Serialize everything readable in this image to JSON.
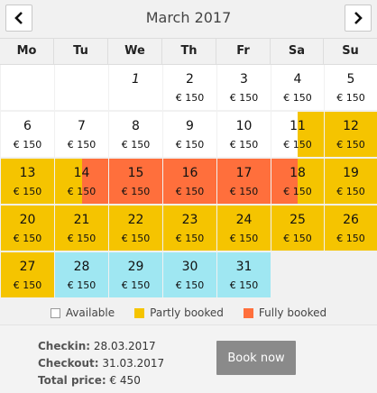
{
  "header": {
    "month": "March 2017"
  },
  "weekdays": [
    "Mo",
    "Tu",
    "We",
    "Th",
    "Fr",
    "Sa",
    "Su"
  ],
  "colors": {
    "available": "#ffffff",
    "partly": "#f5c400",
    "fully": "#ff6f3c",
    "selected": "#9fe7f2"
  },
  "calendar": {
    "days": [
      {
        "day": "1",
        "price": "",
        "status": "available",
        "italic": true
      },
      {
        "day": "2",
        "price": "€ 150",
        "status": "available"
      },
      {
        "day": "3",
        "price": "€ 150",
        "status": "available"
      },
      {
        "day": "4",
        "price": "€ 150",
        "status": "available"
      },
      {
        "day": "5",
        "price": "€ 150",
        "status": "available"
      },
      {
        "day": "6",
        "price": "€ 150",
        "status": "available"
      },
      {
        "day": "7",
        "price": "€ 150",
        "status": "available"
      },
      {
        "day": "8",
        "price": "€ 150",
        "status": "available"
      },
      {
        "day": "9",
        "price": "€ 150",
        "status": "available"
      },
      {
        "day": "10",
        "price": "€ 150",
        "status": "available"
      },
      {
        "day": "11",
        "price": "€ 150",
        "status": "partly-checkin"
      },
      {
        "day": "12",
        "price": "€ 150",
        "status": "partly"
      },
      {
        "day": "13",
        "price": "€ 150",
        "status": "partly"
      },
      {
        "day": "14",
        "price": "€ 150",
        "status": "fully-checkin"
      },
      {
        "day": "15",
        "price": "€ 150",
        "status": "fully"
      },
      {
        "day": "16",
        "price": "€ 150",
        "status": "fully"
      },
      {
        "day": "17",
        "price": "€ 150",
        "status": "fully"
      },
      {
        "day": "18",
        "price": "€ 150",
        "status": "fully-checkout"
      },
      {
        "day": "19",
        "price": "€ 150",
        "status": "partly"
      },
      {
        "day": "20",
        "price": "€ 150",
        "status": "partly"
      },
      {
        "day": "21",
        "price": "€ 150",
        "status": "partly"
      },
      {
        "day": "22",
        "price": "€ 150",
        "status": "partly"
      },
      {
        "day": "23",
        "price": "€ 150",
        "status": "partly"
      },
      {
        "day": "24",
        "price": "€ 150",
        "status": "partly"
      },
      {
        "day": "25",
        "price": "€ 150",
        "status": "partly"
      },
      {
        "day": "26",
        "price": "€ 150",
        "status": "partly"
      },
      {
        "day": "27",
        "price": "€ 150",
        "status": "partly"
      },
      {
        "day": "28",
        "price": "€ 150",
        "status": "selected"
      },
      {
        "day": "29",
        "price": "€ 150",
        "status": "selected"
      },
      {
        "day": "30",
        "price": "€ 150",
        "status": "selected"
      },
      {
        "day": "31",
        "price": "€ 150",
        "status": "selected"
      }
    ]
  },
  "legend": {
    "available": "Available",
    "partly": "Partly booked",
    "fully": "Fully booked"
  },
  "summary": {
    "checkin_label": "Checkin:",
    "checkin_value": "28.03.2017",
    "checkout_label": "Checkout:",
    "checkout_value": "31.03.2017",
    "total_label": "Total price:",
    "total_value": "€ 450"
  },
  "book_button": "Book now"
}
